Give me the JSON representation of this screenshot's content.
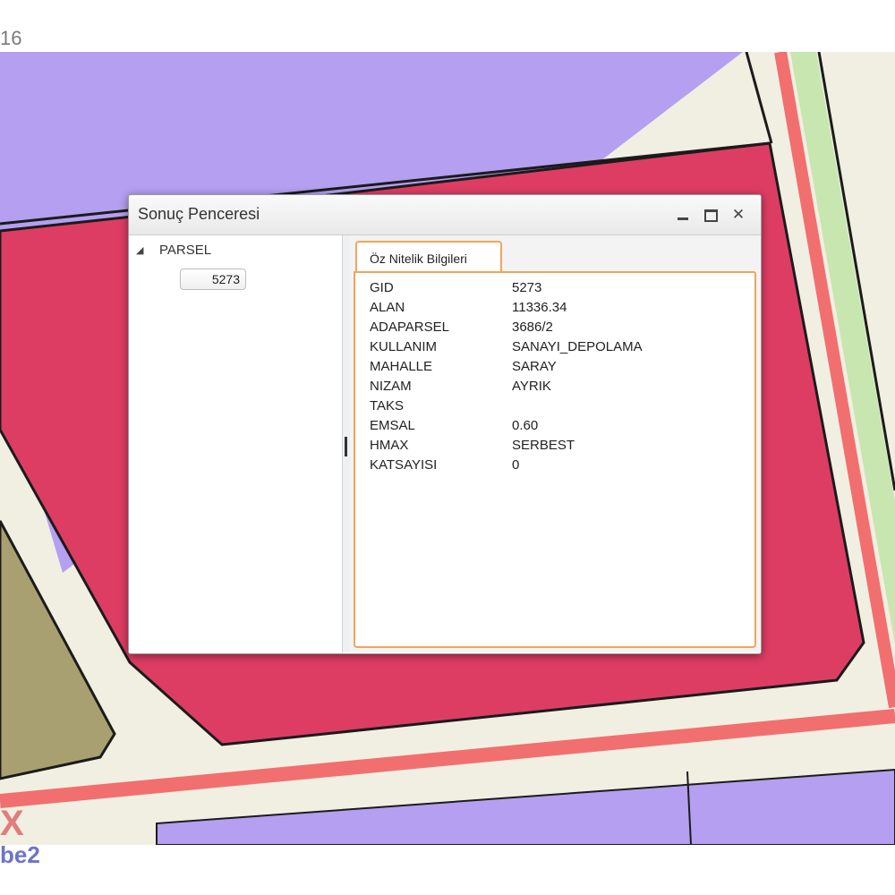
{
  "page": {
    "top_label": "16",
    "logo_mark": "X",
    "logo_text": "be2"
  },
  "colors": {
    "industrial_parcel": "#dd3d63",
    "residential_zone": "#b49ff0",
    "green_zone": "#a8a070",
    "road": "#f1efe2",
    "road_line": "#f26f6f",
    "tab_border": "#f0a55a"
  },
  "window": {
    "title": "Sonuç Penceresi",
    "controls": {
      "minimize_icon": "minimize-icon",
      "maximize_icon": "maximize-icon",
      "close_icon": "close-icon",
      "close_label": "✕"
    }
  },
  "tree": {
    "toggle_icon": "triangle-down-icon",
    "toggle_glyph": "◢",
    "root_label": "PARSEL",
    "items": [
      {
        "label": "5273"
      }
    ]
  },
  "tabs": [
    {
      "label": "Öz Nitelik Bilgileri",
      "active": true
    }
  ],
  "attributes": [
    {
      "key": "GID",
      "value": "5273"
    },
    {
      "key": "ALAN",
      "value": "11336.34"
    },
    {
      "key": "ADAPARSEL",
      "value": "3686/2"
    },
    {
      "key": "KULLANIM",
      "value": "SANAYI_DEPOLAMA"
    },
    {
      "key": "MAHALLE",
      "value": "SARAY"
    },
    {
      "key": "NIZAM",
      "value": "AYRIK"
    },
    {
      "key": "TAKS",
      "value": ""
    },
    {
      "key": "EMSAL",
      "value": "0.60"
    },
    {
      "key": "HMAX",
      "value": "SERBEST"
    },
    {
      "key": "KATSAYISI",
      "value": "0"
    }
  ]
}
